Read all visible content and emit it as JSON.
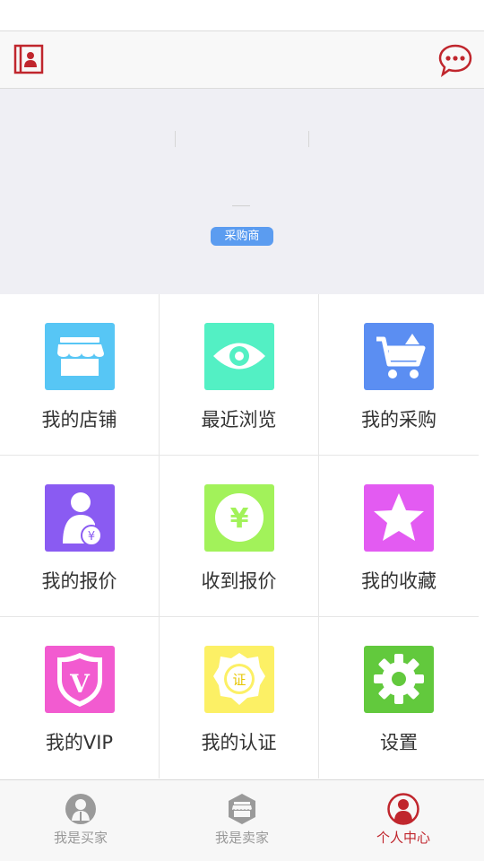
{
  "profile": {
    "role_badge": "采购商"
  },
  "grid": [
    {
      "label": "我的店铺",
      "icon": "store-icon",
      "color": "#57c6f5"
    },
    {
      "label": "最近浏览",
      "icon": "eye-icon",
      "color": "#53f0c4"
    },
    {
      "label": "我的采购",
      "icon": "cart-icon",
      "color": "#5b8ef2"
    },
    {
      "label": "我的报价",
      "icon": "person-quote-icon",
      "color": "#8a5bf2"
    },
    {
      "label": "收到报价",
      "icon": "yen-coin-icon",
      "color": "#a2f25a"
    },
    {
      "label": "我的收藏",
      "icon": "star-icon",
      "color": "#e35bf2"
    },
    {
      "label": "我的VIP",
      "icon": "vip-shield-icon",
      "color": "#f25bd0"
    },
    {
      "label": "我的认证",
      "icon": "certificate-badge-icon",
      "color": "#fcf065"
    },
    {
      "label": "设置",
      "icon": "gear-icon",
      "color": "#62c93d"
    }
  ],
  "tabbar": {
    "tabs": [
      {
        "label": "我是买家",
        "icon": "buyer-person-icon"
      },
      {
        "label": "我是卖家",
        "icon": "seller-store-icon"
      },
      {
        "label": "个人中心",
        "icon": "profile-center-icon"
      }
    ],
    "active_color": "#c0262d",
    "inactive_color": "#999999"
  },
  "colors": {
    "accent": "#c0262d",
    "badge": "#5b9cf0"
  }
}
